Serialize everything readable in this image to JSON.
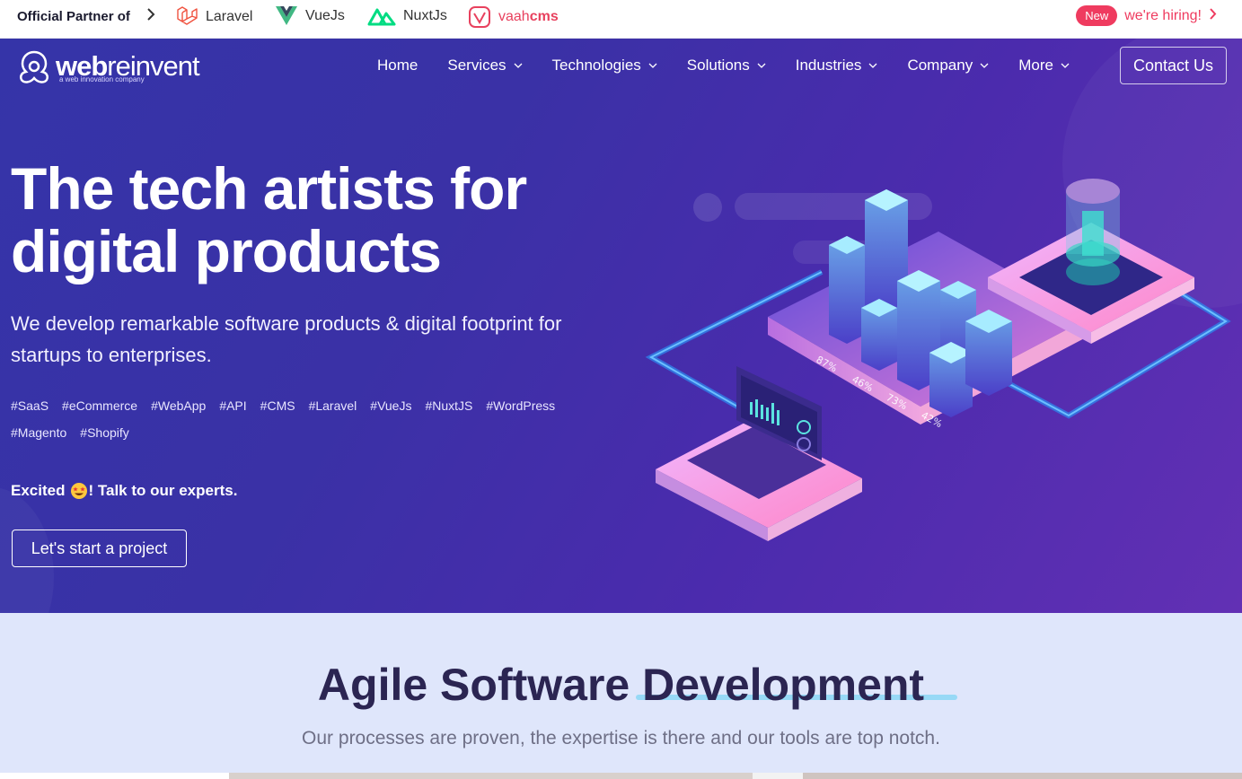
{
  "topbar": {
    "partner_label": "Official Partner of",
    "partners": [
      {
        "name": "Laravel",
        "color": "#f05340"
      },
      {
        "name": "VueJs",
        "color": "#41b883"
      },
      {
        "name": "NuxtJs",
        "color": "#00dc82"
      },
      {
        "name_light": "vaah",
        "name_bold": "cms",
        "color": "#e8415e"
      }
    ],
    "hiring": {
      "badge": "New",
      "text": "we're hiring!"
    }
  },
  "header": {
    "logo": {
      "light": "reinvent",
      "bold": "web",
      "tagline": "a web innovation company"
    },
    "nav": [
      {
        "label": "Home",
        "dropdown": false
      },
      {
        "label": "Services",
        "dropdown": true
      },
      {
        "label": "Technologies",
        "dropdown": true
      },
      {
        "label": "Solutions",
        "dropdown": true
      },
      {
        "label": "Industries",
        "dropdown": true
      },
      {
        "label": "Company",
        "dropdown": true
      },
      {
        "label": "More",
        "dropdown": true
      }
    ],
    "contact_button": "Contact Us"
  },
  "hero": {
    "title_line1": "The tech artists for",
    "title_line2": "digital products",
    "subtitle": "We develop remarkable software products & digital footprint for startups to enterprises.",
    "tags": [
      "#SaaS",
      "#eCommerce",
      "#WebApp",
      "#API",
      "#CMS",
      "#Laravel",
      "#VueJs",
      "#NuxtJS",
      "#WordPress",
      "#Magento",
      "#Shopify"
    ],
    "cta_prefix": "Excited",
    "cta_suffix": "! Talk to our experts.",
    "start_button": "Let's start a project",
    "chart_labels": [
      "87%",
      "46%",
      "73%",
      "42%"
    ],
    "colors": {
      "gradient_start": "#3534a8",
      "gradient_end": "#6230b4"
    }
  },
  "agile": {
    "title": "Agile Software Development",
    "subtitle": "Our processes are proven, the expertise is there and our tools are top notch."
  }
}
